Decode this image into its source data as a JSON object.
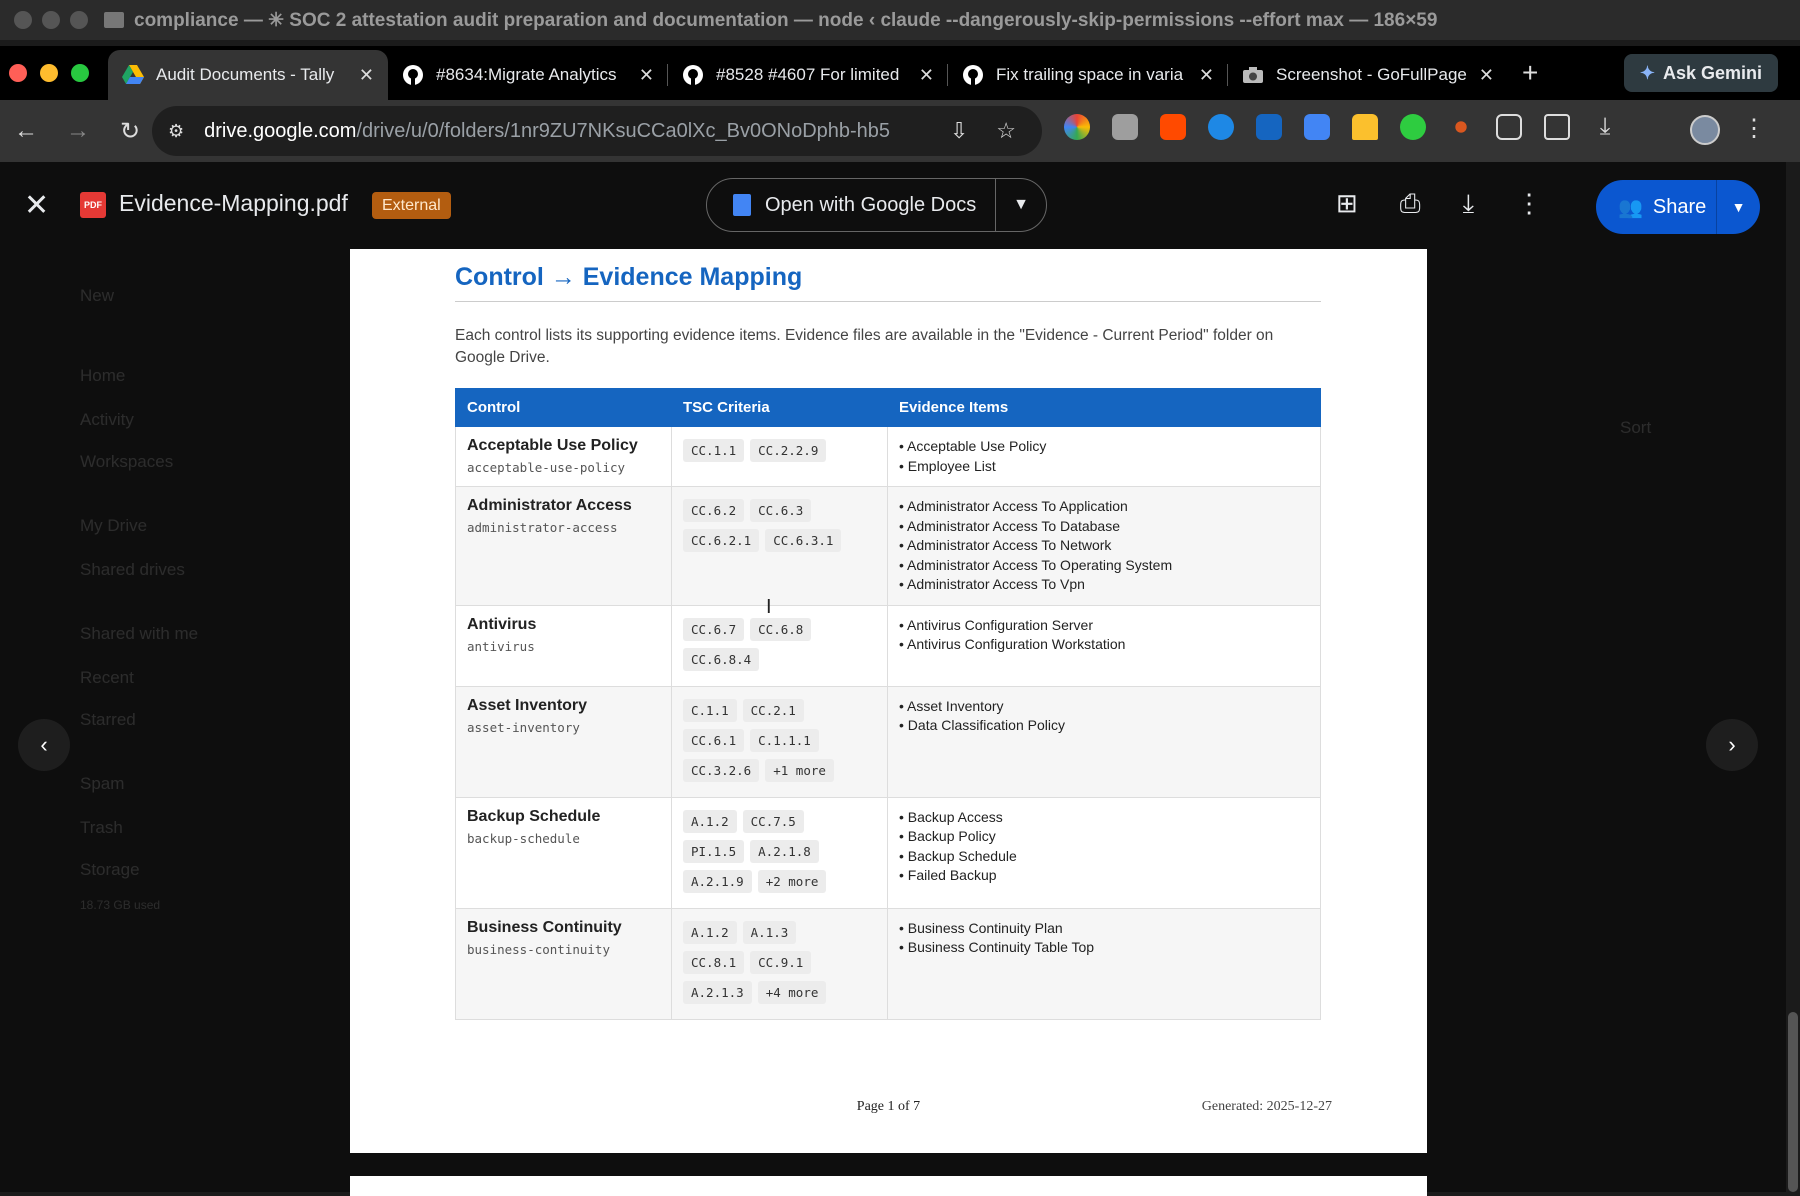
{
  "os_window": {
    "title": "compliance — ✳ SOC 2 attestation audit preparation and documentation — node ‹ claude --dangerously-skip-permissions --effort max — 186×59"
  },
  "browser": {
    "tabs": [
      {
        "label": "Audit Documents - Tally",
        "icon": "google-drive-icon",
        "active": true
      },
      {
        "label": "#8634:Migrate Analytics",
        "icon": "github-icon"
      },
      {
        "label": "#8528 #4607 For limited",
        "icon": "github-icon"
      },
      {
        "label": "Fix trailing space in varia",
        "icon": "github-icon"
      },
      {
        "label": "Screenshot - GoFullPage",
        "icon": "camera-icon"
      }
    ],
    "ask_gemini": "Ask Gemini",
    "url_host": "drive.google.com",
    "url_path": "/drive/u/0/folders/1nr9ZU7NKsuCCa0lXc_Bv0ONoDphb-hb5"
  },
  "viewer": {
    "file_name": "Evidence-Mapping.pdf",
    "pdf_badge": "PDF",
    "external_label": "External",
    "open_with": "Open with Google Docs",
    "share": "Share"
  },
  "drive_bg": [
    "New",
    "Home",
    "Activity",
    "Workspaces",
    "My Drive",
    "Shared drives",
    "Shared with me",
    "Recent",
    "Starred",
    "Spam",
    "Trash",
    "Storage",
    "18.73 GB used",
    "Sort"
  ],
  "document": {
    "title": "Control → Evidence Mapping",
    "description": "Each control lists its supporting evidence items. Evidence files are available in the \"Evidence - Current Period\" folder on Google Drive.",
    "headers": [
      "Control",
      "TSC Criteria",
      "Evidence Items"
    ],
    "rows": [
      {
        "name": "Acceptable Use Policy",
        "slug": "acceptable-use-policy",
        "tsc": [
          "CC.1.1",
          "CC.2.2.9"
        ],
        "evidence": [
          "Acceptable Use Policy",
          "Employee List"
        ]
      },
      {
        "name": "Administrator Access",
        "slug": "administrator-access",
        "tsc": [
          "CC.6.2",
          "CC.6.3",
          "CC.6.2.1",
          "CC.6.3.1"
        ],
        "evidence": [
          "Administrator Access To Application",
          "Administrator Access To Database",
          "Administrator Access To Network",
          "Administrator Access To Operating System",
          "Administrator Access To Vpn"
        ]
      },
      {
        "name": "Antivirus",
        "slug": "antivirus",
        "tsc": [
          "CC.6.7",
          "CC.6.8",
          "CC.6.8.4"
        ],
        "evidence": [
          "Antivirus Configuration Server",
          "Antivirus Configuration Workstation"
        ]
      },
      {
        "name": "Asset Inventory",
        "slug": "asset-inventory",
        "tsc": [
          "C.1.1",
          "CC.2.1",
          "CC.6.1",
          "C.1.1.1",
          "CC.3.2.6",
          "+1 more"
        ],
        "evidence": [
          "Asset Inventory",
          "Data Classification Policy"
        ]
      },
      {
        "name": "Backup Schedule",
        "slug": "backup-schedule",
        "tsc": [
          "A.1.2",
          "CC.7.5",
          "PI.1.5",
          "A.2.1.8",
          "A.2.1.9",
          "+2 more"
        ],
        "evidence": [
          "Backup Access",
          "Backup Policy",
          "Backup Schedule",
          "Failed Backup"
        ]
      },
      {
        "name": "Business Continuity",
        "slug": "business-continuity",
        "tsc": [
          "A.1.2",
          "A.1.3",
          "CC.8.1",
          "CC.9.1",
          "A.2.1.3",
          "+4 more"
        ],
        "evidence": [
          "Business Continuity Plan",
          "Business Continuity Table Top"
        ]
      }
    ],
    "page_number": "Page 1 of 7",
    "generated": "Generated: 2025-12-27"
  }
}
